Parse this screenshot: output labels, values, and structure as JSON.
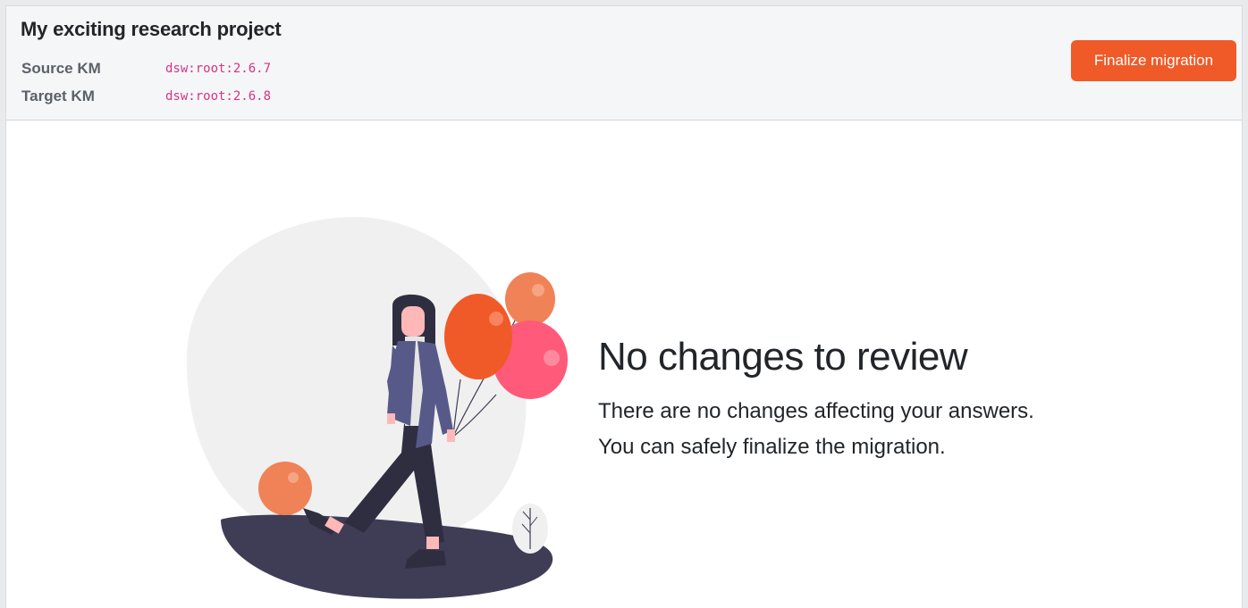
{
  "header": {
    "project_title": "My exciting research project",
    "source_label": "Source KM",
    "source_value": "dsw:root:2.6.7",
    "target_label": "Target KM",
    "target_value": "dsw:root:2.6.8",
    "finalize_label": "Finalize migration"
  },
  "main": {
    "illustration_icon": "woman-with-balloons-illustration",
    "title": "No changes to review",
    "line1": "There are no changes affecting your answers.",
    "line2": "You can safely finalize the migration."
  },
  "colors": {
    "accent": "#f05a28",
    "code": "#d63384"
  }
}
